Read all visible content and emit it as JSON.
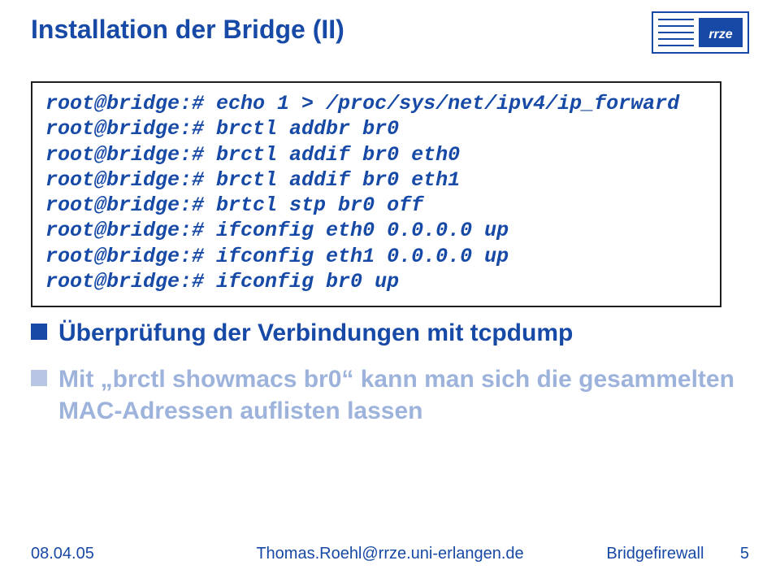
{
  "title": "Installation der Bridge (II)",
  "code": {
    "lines": [
      "root@bridge:# echo 1 > /proc/sys/net/ipv4/ip_forward",
      "root@bridge:# brctl addbr br0",
      "root@bridge:# brctl addif br0 eth0",
      "root@bridge:# brctl addif br0 eth1",
      "root@bridge:# brtcl stp br0 off",
      "root@bridge:# ifconfig eth0 0.0.0.0 up",
      "root@bridge:# ifconfig eth1 0.0.0.0 up",
      "root@bridge:# ifconfig br0 up"
    ]
  },
  "bullets": [
    {
      "text": "Überprüfung der Verbindungen mit tcpdump",
      "active": true
    },
    {
      "text": "Mit „brctl showmacs br0“ kann man sich die gesammelten MAC-Adressen auflisten lassen",
      "active": false
    }
  ],
  "footer": {
    "date": "08.04.05",
    "email": "Thomas.Roehl@rrze.uni-erlangen.de",
    "project": "Bridgefirewall",
    "page": "5"
  },
  "logo": {
    "name": "RRZE"
  }
}
